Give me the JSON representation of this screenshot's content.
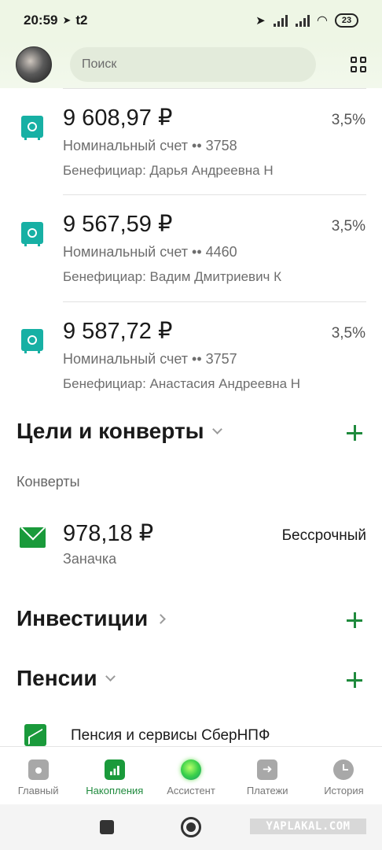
{
  "status_bar": {
    "time": "20:59",
    "carrier": "t2",
    "battery": "23"
  },
  "header": {
    "search_placeholder": "Поиск"
  },
  "accounts": [
    {
      "amount": "9 608,97 ₽",
      "rate": "3,5%",
      "account_line": "Номинальный счет •• 3758",
      "beneficiary": "Бенефициар: Дарья Андреевна Н"
    },
    {
      "amount": "9 567,59 ₽",
      "rate": "3,5%",
      "account_line": "Номинальный счет •• 4460",
      "beneficiary": "Бенефициар: Вадим Дмитриевич К"
    },
    {
      "amount": "9 587,72 ₽",
      "rate": "3,5%",
      "account_line": "Номинальный счет •• 3757",
      "beneficiary": "Бенефициар: Анастасия Андреевна Н"
    }
  ],
  "goals": {
    "title": "Цели и конверты",
    "subheading": "Конверты",
    "envelope": {
      "amount": "978,18 ₽",
      "name": "Заначка",
      "term": "Бессрочный"
    }
  },
  "investments": {
    "title": "Инвестиции"
  },
  "pensions": {
    "title": "Пенсии",
    "item_label": "Пенсия и сервисы СберНПФ"
  },
  "bottom_nav": {
    "items": [
      {
        "label": "Главный",
        "icon": "home-icon",
        "active": false
      },
      {
        "label": "Накопления",
        "icon": "savings-icon",
        "active": true
      },
      {
        "label": "Ассистент",
        "icon": "assistant-icon",
        "active": false
      },
      {
        "label": "Платежи",
        "icon": "payments-icon",
        "active": false
      },
      {
        "label": "История",
        "icon": "history-icon",
        "active": false
      }
    ]
  },
  "watermark": "YAPLAKAL.COM",
  "colors": {
    "accent_green": "#1f8a3d",
    "teal_icon": "#17b0a4",
    "header_bg": "#eef6e5"
  }
}
